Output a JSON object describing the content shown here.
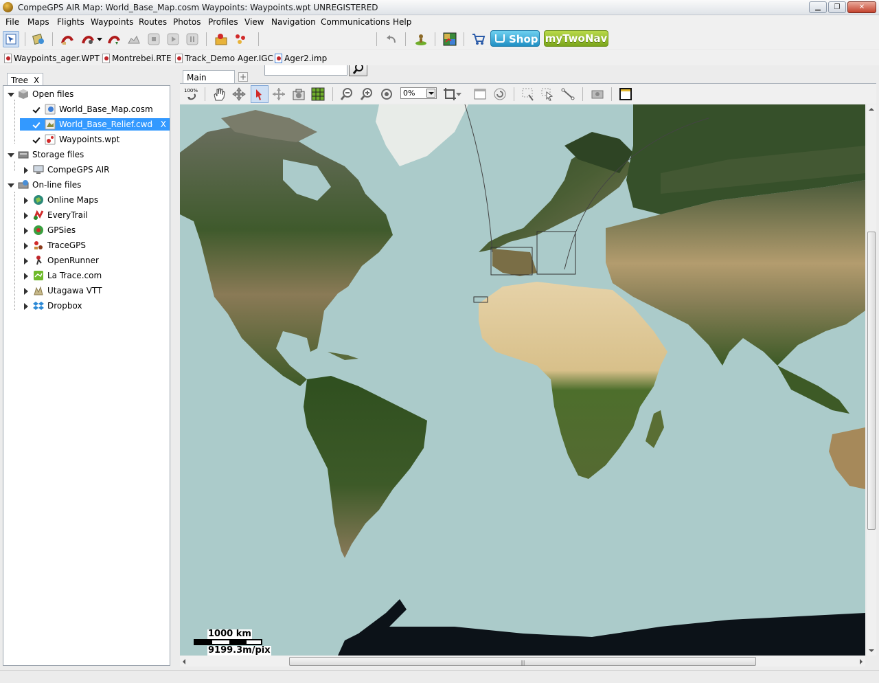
{
  "window": {
    "title": "CompeGPS AIR Map: World_Base_Map.cosm Waypoints:  Waypoints.wpt UNREGISTERED",
    "controls": [
      "minimize",
      "restore",
      "close"
    ]
  },
  "menu": [
    "File",
    "Maps",
    "Flights",
    "Waypoints",
    "Routes",
    "Photos",
    "Profiles",
    "View",
    "Navigation",
    "Communications",
    "Help"
  ],
  "toolbar": {
    "search_value": "",
    "shop_label": "Shop",
    "mytwonav_label": "myTwoNav"
  },
  "open_files_tabs": [
    "Waypoints_ager.WPT",
    "Montrebei.RTE",
    "Track_Demo Ager.IGC",
    "Ager2.imp"
  ],
  "tree": {
    "tab_label": "Tree",
    "tab_close": "X",
    "groups": [
      {
        "label": "Open files",
        "items": [
          "World_Base_Map.cosm",
          "World_Base_Relief.cwdem",
          "Waypoints.wpt"
        ]
      },
      {
        "label": "Storage files",
        "items": [
          "CompeGPS AIR"
        ]
      },
      {
        "label": "On-line files",
        "items": [
          "Online Maps",
          "EveryTrail",
          "GPSies",
          "TraceGPS",
          "OpenRunner",
          "La Trace.com",
          "Utagawa VTT",
          "Dropbox"
        ]
      }
    ],
    "selected_close": "X"
  },
  "main_window": {
    "tab_label": "Main window",
    "add_tab": "+",
    "zoom_level": "0%",
    "zoom_reset_label": "100%",
    "scale_distance": "1000 km",
    "scale_resolution": "9199.3m/pix"
  },
  "colors": {
    "ocean": "#abcbca",
    "selection": "#3399ff",
    "shop": "#1f8fc4",
    "mytwonav": "#7aa51a"
  }
}
